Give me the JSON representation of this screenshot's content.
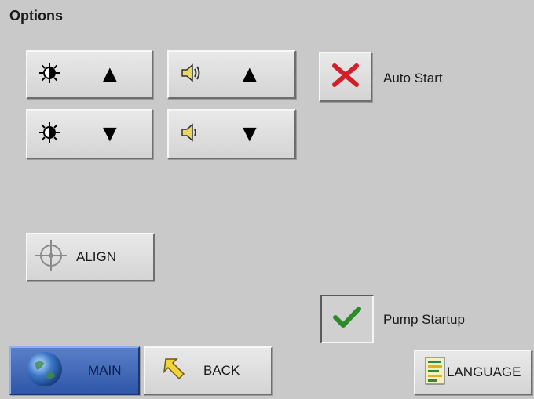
{
  "title": "Options",
  "controls": {
    "brightness_icon": "brightness-icon",
    "volume_icon": "speaker-icon",
    "up_glyph": "▲",
    "down_glyph": "▼"
  },
  "auto_start": {
    "label": "Auto Start",
    "checked": false,
    "icon": "x-icon",
    "color": "#d21f2a"
  },
  "align": {
    "label": "ALIGN",
    "icon": "crosshair-icon"
  },
  "pump_startup": {
    "label": "Pump Startup",
    "checked": true,
    "icon": "check-icon",
    "color": "#2d8a2a"
  },
  "nav": {
    "main": "MAIN",
    "back": "BACK",
    "language": "LANGUAGE"
  },
  "colors": {
    "main_button": "#3a62b5"
  }
}
